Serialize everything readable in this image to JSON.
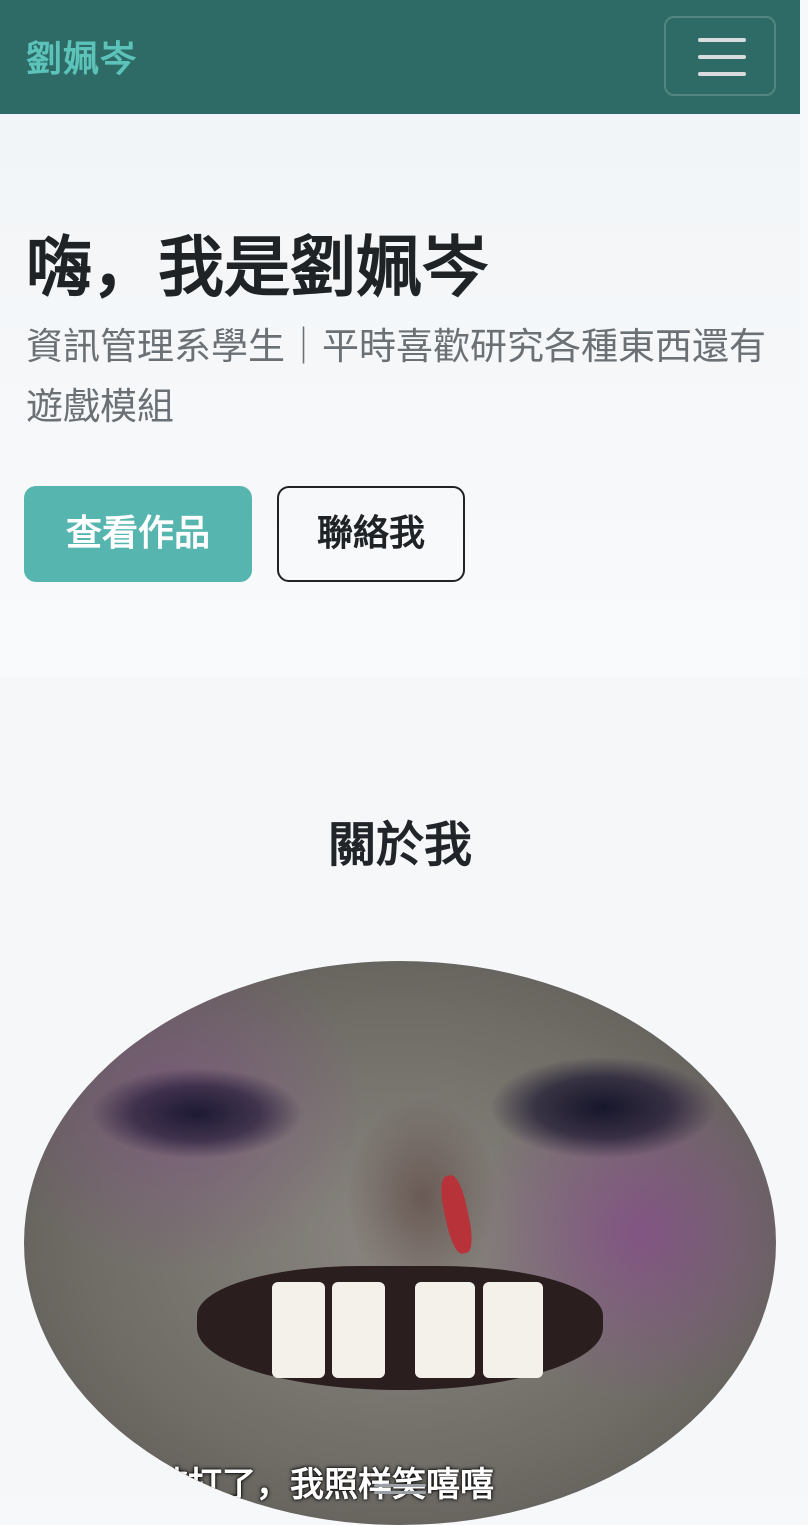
{
  "navbar": {
    "brand": "劉姵岑",
    "toggle_icon": "hamburger-menu-icon"
  },
  "hero": {
    "title": "嗨，我是劉姵岑",
    "subtitle": "資訊管理系學生｜平時喜歡研究各種東西還有遊戲模組",
    "primary_button": "查看作品",
    "secondary_button": "聯絡我"
  },
  "about": {
    "heading": "關於我",
    "photo_caption": "被打了，我照样笑嘻嘻"
  },
  "colors": {
    "navbar_bg": "#2f6b66",
    "brand": "#5cc3bb",
    "primary_button": "#57b5af"
  }
}
